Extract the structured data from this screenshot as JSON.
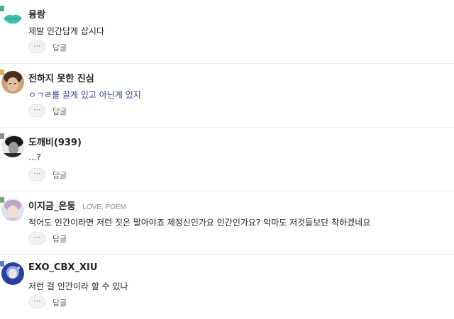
{
  "comments": [
    {
      "author": "융랑",
      "tag": "",
      "body": "제발 인간답게 삽시다",
      "more": "⋯",
      "reply": "답글",
      "level_color": "#4caf7a",
      "avatar_type": "lips"
    },
    {
      "author": "전하지 못한 진심",
      "tag": "",
      "body": "ㅇㄱㄹ를 끌게 있고 아닌게 있지",
      "more": "⋯",
      "reply": "답글",
      "level_color": "#d9b14a",
      "avatar_type": "portrait-warm"
    },
    {
      "author": "도깨비(939)",
      "tag": "",
      "body": "...?",
      "more": "⋯",
      "reply": "답글",
      "level_color": "#8a8a8a",
      "avatar_type": "portrait-gray"
    },
    {
      "author": "이지금_은둥",
      "tag": "LOVE, POEM",
      "body": "적어도 인간이라면 저런 짓은 말아야죠 제정신인가요 인간인가요? 악마도 저것들보단 착하겠네요",
      "more": "⋯",
      "reply": "답글",
      "level_color": "#6fae6f",
      "avatar_type": "portrait-light"
    },
    {
      "author": "EXO_CBX_XIU",
      "tag": "",
      "body": "저런 걸 인간이라 할 수 있나",
      "more": "⋯",
      "reply": "답글",
      "level_color": "#5b7bd6",
      "avatar_type": "portrait-blue"
    }
  ]
}
